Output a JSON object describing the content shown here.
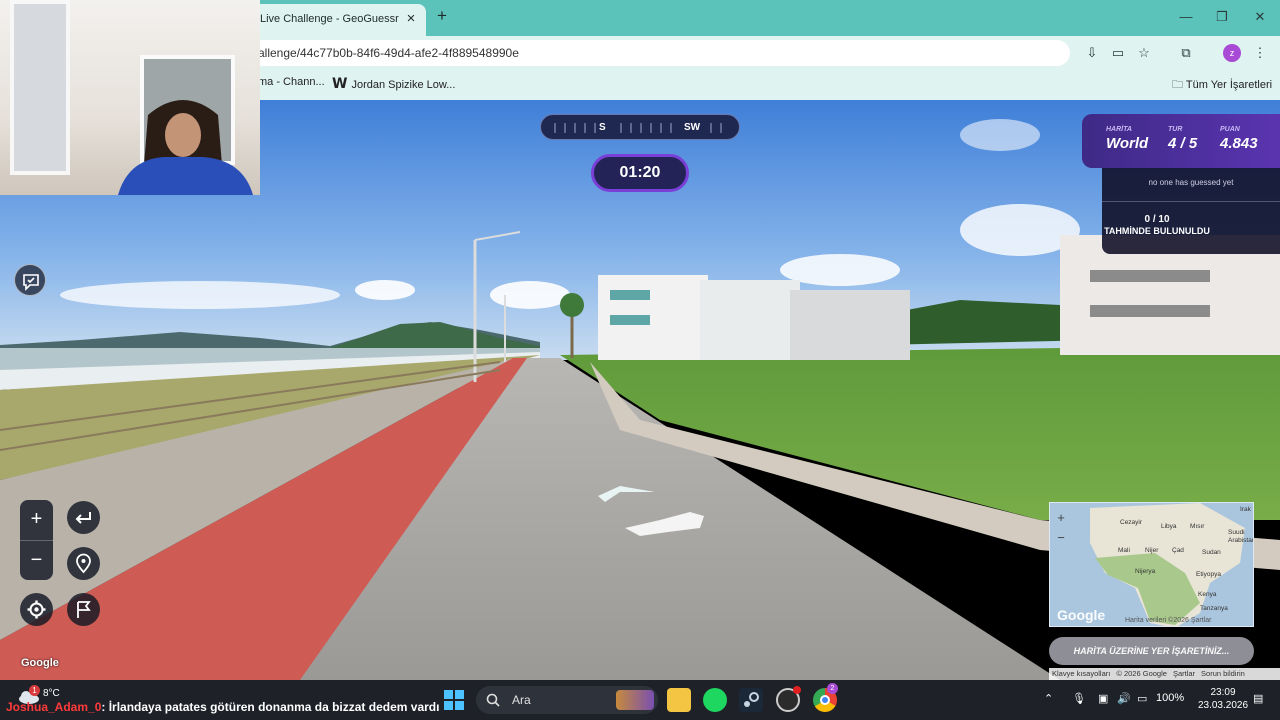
{
  "browser": {
    "tab_title": "Live Challenge - GeoGuessr",
    "url": "allenge/44c77b0b-84f6-49d4-afe2-4f889548990e",
    "bookmarks": [
      "ma - Chann...",
      "Jordan Spizike Low..."
    ],
    "all_bookmarks": "Tüm Yer İşaretleri",
    "profile_initial": "z"
  },
  "game": {
    "compass": {
      "s": "S",
      "sw": "SW"
    },
    "timer": "01:20",
    "map_label": "HARİTA",
    "map_value": "World",
    "round_label": "TUR",
    "round_value": "4 / 5",
    "score_label": "PUAN",
    "score_value": "4.843",
    "no_guess": "no one has guessed yet",
    "guess_count": "0 / 10",
    "guess_found": "TAHMİNDE BULUNULDU",
    "place_button": "HARİTA ÜZERİNE YER İŞARETİNİZ...",
    "google": "Google"
  },
  "minimap": {
    "labels": [
      "Cezayir",
      "Libya",
      "Mısır",
      "Irak",
      "Suudi Arabistan",
      "Mali",
      "Nijer",
      "Çad",
      "Sudan",
      "Nijerya",
      "Etiyopya",
      "Kenya",
      "Tanzanya"
    ],
    "google": "Google",
    "attribution": "Harita verileri ©2026   Şartlar"
  },
  "attribution_bar": [
    "Klavye kısayolları",
    "© 2026 Google",
    "Şartlar",
    "Sorun bildirin"
  ],
  "taskbar": {
    "temperature": "8°C",
    "badge": "1",
    "chat_user": "Joshua_Adam_0",
    "chat_message": ": İrlandaya patates götüren donanma da bizzat dedem vardı",
    "search": "Ara",
    "battery": "100%",
    "time": "23:09",
    "date": "23.03.2026",
    "chrome_badge": "2"
  }
}
